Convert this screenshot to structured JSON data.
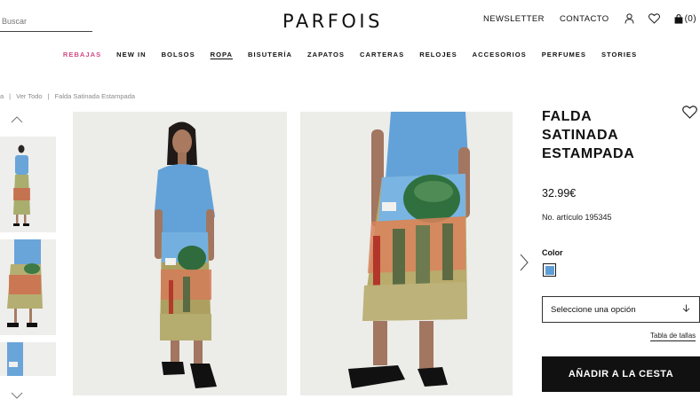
{
  "header": {
    "search_placeholder": "Buscar",
    "logo": "PARFOIS",
    "newsletter": "NEWSLETTER",
    "contact": "CONTACTO",
    "cart_count": "(0)"
  },
  "nav": {
    "items": [
      "REBAJAS",
      "NEW IN",
      "BOLSOS",
      "ROPA",
      "BISUTERÍA",
      "ZAPATOS",
      "CARTERAS",
      "RELOJES",
      "ACCESORIOS",
      "PERFUMES",
      "STORIES"
    ]
  },
  "breadcrumb": {
    "items": [
      "a",
      "Ver Todo",
      "Falda Satinada Estampada"
    ],
    "separator": "|"
  },
  "product": {
    "title": "FALDA SATINADA ESTAMPADA",
    "price": "32.99€",
    "article_number": "No. artículo 195345",
    "color_label": "Color",
    "swatch_color": "#5e9dd6",
    "size_select_placeholder": "Seleccione una opción",
    "size_table": "Tabla de tallas",
    "add_to_cart": "AÑADIR A LA CESTA"
  },
  "icons": [
    "user-icon",
    "heart-icon",
    "bag-icon",
    "chevron-up-icon",
    "chevron-down-icon",
    "chevron-right-icon",
    "heart-outline-icon",
    "chevron-down-select-icon"
  ]
}
